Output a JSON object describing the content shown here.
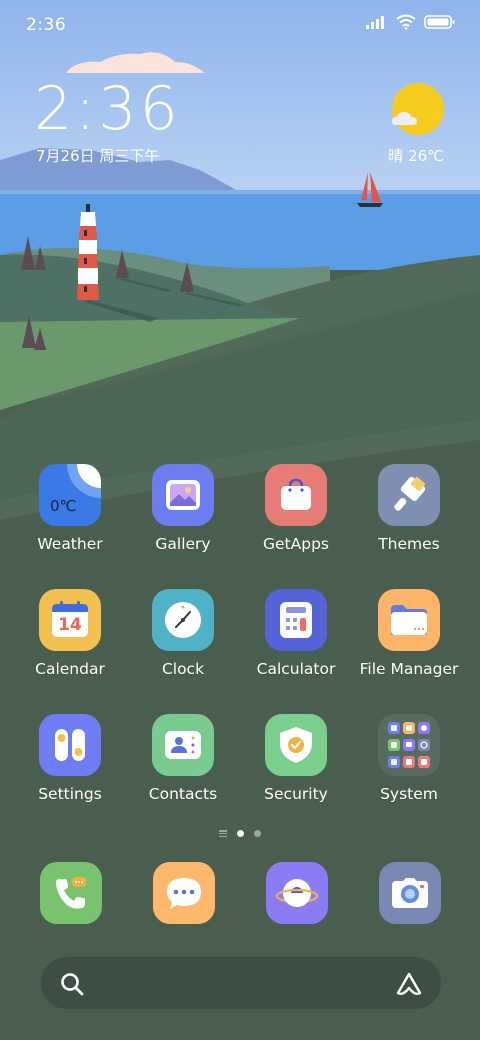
{
  "status_bar": {
    "time": "2:36"
  },
  "widget": {
    "time": "2:36",
    "date": "7月26日 周三下午",
    "weather": "晴 26℃",
    "weather_icon": "sun-icon"
  },
  "apps": [
    {
      "label": "Weather",
      "icon": "weather-icon",
      "color": "#3a79e6",
      "icon_text": "0℃"
    },
    {
      "label": "Gallery",
      "icon": "gallery-icon",
      "color": "#6c7df0"
    },
    {
      "label": "GetApps",
      "icon": "getapps-icon",
      "color": "#e77b76"
    },
    {
      "label": "Themes",
      "icon": "themes-icon",
      "color": "#7f8fb0"
    },
    {
      "label": "Calendar",
      "icon": "calendar-icon",
      "color": "#f1c04f",
      "icon_text": "14"
    },
    {
      "label": "Clock",
      "icon": "clock-icon",
      "color": "#4fb2c7"
    },
    {
      "label": "Calculator",
      "icon": "calculator-icon",
      "color": "#5564d6"
    },
    {
      "label": "File Manager",
      "icon": "folder-icon",
      "color": "#fcb468"
    },
    {
      "label": "Settings",
      "icon": "settings-icon",
      "color": "#6e7ef2"
    },
    {
      "label": "Contacts",
      "icon": "contacts-icon",
      "color": "#7acb90"
    },
    {
      "label": "Security",
      "icon": "security-icon",
      "color": "#7bcf8e"
    },
    {
      "label": "System",
      "icon": "folder-system-icon",
      "color": "#596a61"
    }
  ],
  "dock": [
    {
      "name": "phone",
      "icon": "phone-icon",
      "color": "#79c36e"
    },
    {
      "name": "messages",
      "icon": "messages-icon",
      "color": "#fdb86c"
    },
    {
      "name": "browser",
      "icon": "browser-icon",
      "color": "#8b7cf5"
    },
    {
      "name": "camera",
      "icon": "camera-icon",
      "color": "#7989b4"
    }
  ],
  "page_indicator": {
    "current": 1,
    "total": 2
  }
}
